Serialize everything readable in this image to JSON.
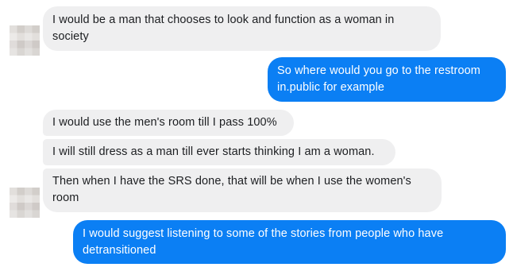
{
  "conversation": {
    "messages": [
      {
        "sender": "contact",
        "text": "I would be a man that chooses to look and function as a woman in society"
      },
      {
        "sender": "me",
        "text": "So where would you go to the restroom in.public for example"
      },
      {
        "sender": "contact",
        "text": "I would use the men's room till I pass 100%"
      },
      {
        "sender": "contact",
        "text": "I will still dress as a man till ever starts thinking I am a woman."
      },
      {
        "sender": "contact",
        "text": "Then when I have the SRS done, that will be when I use the women's room"
      },
      {
        "sender": "me",
        "text": "I would suggest listening to some of the stories from people who have detransitioned"
      }
    ],
    "colors": {
      "incoming_bubble": "#efeff0",
      "outgoing_bubble": "#0b7ff4",
      "incoming_text": "#1c1e21",
      "outgoing_text": "#ffffff"
    }
  }
}
